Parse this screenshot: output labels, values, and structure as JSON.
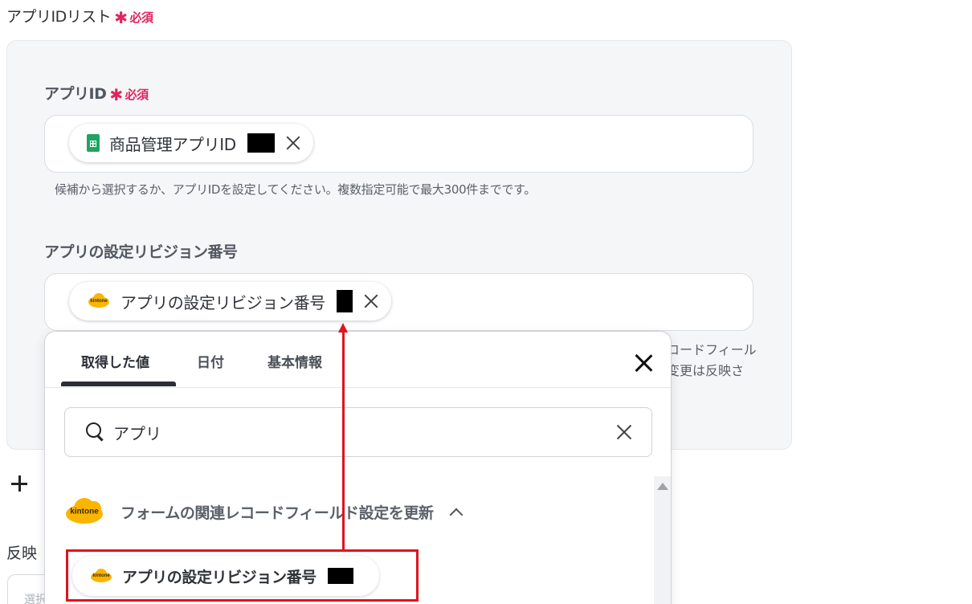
{
  "app_id_list": {
    "label": "アプリIDリスト",
    "required_mark": "✱",
    "required_text": "必須"
  },
  "app_id_field": {
    "label": "アプリID",
    "required_mark": "✱",
    "required_text": "必須",
    "chip": {
      "icon": "google-sheets-icon",
      "text": "商品管理アプリID"
    },
    "help": "候補から選択するか、アプリIDを設定してください。複数指定可能で最大300件までです。"
  },
  "revision_field": {
    "label": "アプリの設定リビジョン番号",
    "chip": {
      "icon": "kintone-logo",
      "text": "アプリの設定リビジョン番号"
    },
    "help_partial_1": "コードフィール",
    "help_partial_2": "変更は反映さ"
  },
  "below": {
    "label_partial": "反映",
    "input_placeholder_partial": "選択"
  },
  "dropdown": {
    "tabs": [
      "取得した値",
      "日付",
      "基本情報"
    ],
    "active_tab": "取得した値",
    "search": {
      "value": "アプリ"
    },
    "group": {
      "logo_text": "kintone",
      "label": "フォームの関連レコードフィールド設定を更新"
    },
    "item": {
      "text": "アプリの設定リビジョン番号"
    }
  },
  "colors": {
    "required": "#e0245e",
    "highlight": "#e0141e",
    "kintone": "#f9b500",
    "sheets": "#1fa463"
  }
}
